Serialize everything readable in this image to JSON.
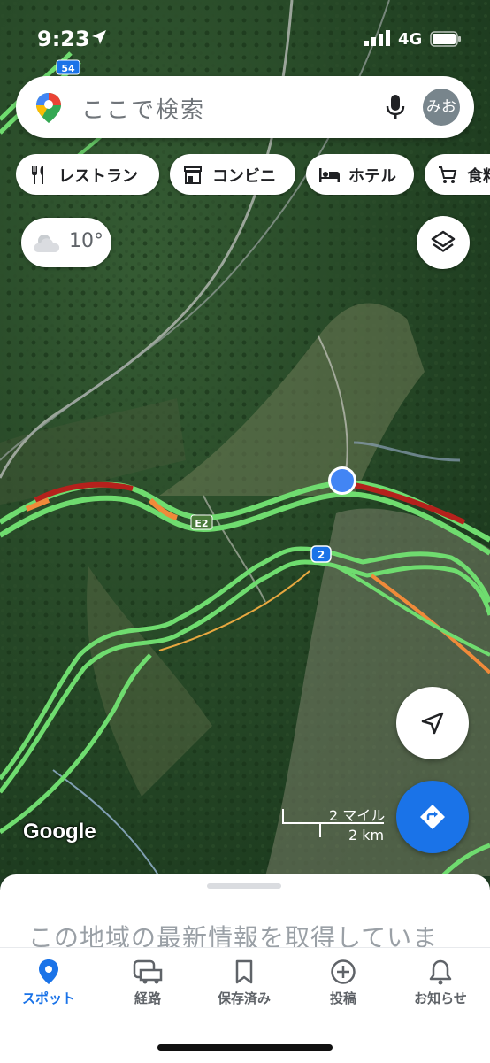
{
  "status_bar": {
    "time": "9:23",
    "network": "4G"
  },
  "search": {
    "placeholder": "ここで検索",
    "avatar_text": "みお"
  },
  "chips": [
    {
      "label": "レストラン",
      "icon": "restaurant-icon"
    },
    {
      "label": "コンビニ",
      "icon": "store-icon"
    },
    {
      "label": "ホテル",
      "icon": "hotel-icon"
    },
    {
      "label": "食料",
      "icon": "cart-icon"
    }
  ],
  "weather": {
    "temp": "10°",
    "icon": "cloud-icon"
  },
  "map": {
    "road_labels": {
      "route_54": "54",
      "expressway": "E2",
      "route_2": "2"
    },
    "logo": "Google",
    "scale": {
      "imperial": "2 マイル",
      "metric": "2 km"
    },
    "colors": {
      "traffic_free": "#6fdc6f",
      "traffic_slow": "#f08a3a",
      "traffic_heavy": "#b5211c",
      "location_dot": "#4285f4"
    }
  },
  "sheet": {
    "message": "この地域の最新情報を取得していま"
  },
  "tabs": [
    {
      "label": "スポット",
      "icon": "pin-icon",
      "active": true
    },
    {
      "label": "経路",
      "icon": "car-icon",
      "active": false
    },
    {
      "label": "保存済み",
      "icon": "bookmark-icon",
      "active": false
    },
    {
      "label": "投稿",
      "icon": "add-circle-icon",
      "active": false
    },
    {
      "label": "お知らせ",
      "icon": "bell-icon",
      "active": false
    }
  ],
  "accent": "#1a73e8"
}
